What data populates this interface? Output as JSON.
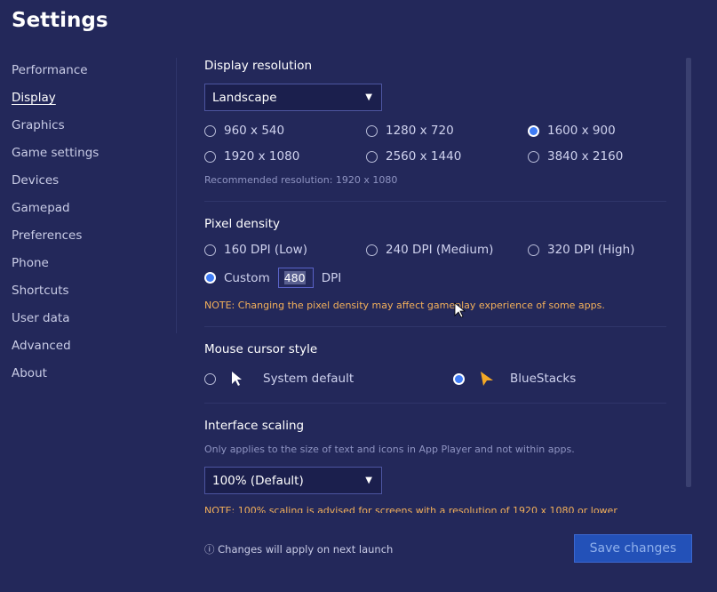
{
  "title": "Settings",
  "sidebar": {
    "items": [
      "Performance",
      "Display",
      "Graphics",
      "Game settings",
      "Devices",
      "Gamepad",
      "Preferences",
      "Phone",
      "Shortcuts",
      "User data",
      "Advanced",
      "About"
    ],
    "active": "Display"
  },
  "display_resolution": {
    "heading": "Display resolution",
    "orientation": "Landscape",
    "options": [
      "960 x 540",
      "1280 x 720",
      "1600 x 900",
      "1920 x 1080",
      "2560 x 1440",
      "3840 x 2160"
    ],
    "selected": "1600 x 900",
    "recommended": "Recommended resolution: 1920 x 1080"
  },
  "pixel_density": {
    "heading": "Pixel density",
    "options": [
      "160 DPI (Low)",
      "240 DPI (Medium)",
      "320 DPI (High)"
    ],
    "custom_label": "Custom",
    "custom_value": "480",
    "unit": "DPI",
    "selected": "Custom",
    "note": "NOTE: Changing the pixel density may affect gameplay experience of some apps."
  },
  "mouse_cursor": {
    "heading": "Mouse cursor style",
    "options": [
      "System default",
      "BlueStacks"
    ],
    "selected": "BlueStacks"
  },
  "interface_scaling": {
    "heading": "Interface scaling",
    "desc": "Only applies to the size of text and icons in App Player and not within apps.",
    "value": "100% (Default)",
    "note": "NOTE: 100% scaling is advised for screens with a resolution of 1920 x 1080 or lower"
  },
  "footer": {
    "info": "Changes will apply on next launch",
    "save": "Save changes"
  },
  "colors": {
    "background": "#23285a",
    "accent": "#3f7cf5",
    "note": "#f3b05a",
    "save_button": "#2351b8"
  }
}
